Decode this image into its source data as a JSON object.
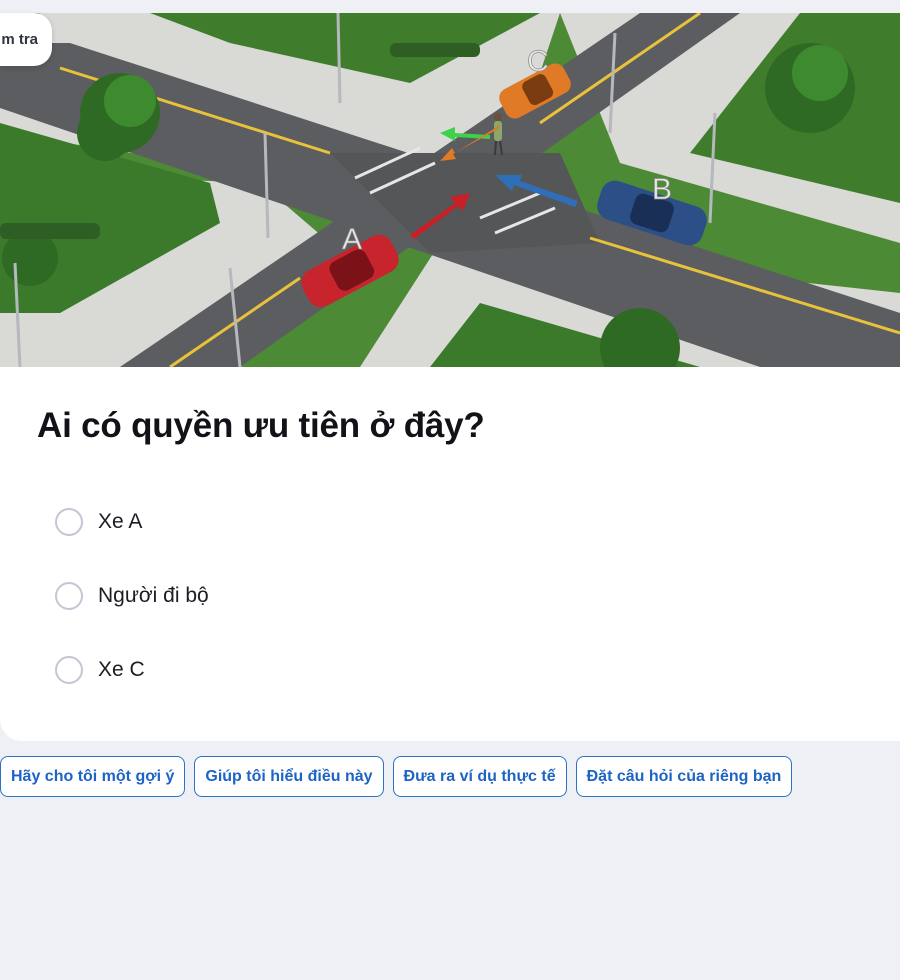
{
  "back_tab": {
    "label": "m tra"
  },
  "scene": {
    "labels": {
      "car_a": "A",
      "car_b": "B",
      "car_c": "C"
    },
    "colors": {
      "car_a": "#c8242e",
      "car_b": "#2b4f86",
      "car_c": "#e07a26"
    }
  },
  "question": {
    "text": "Ai có quyền ưu tiên ở đây?"
  },
  "options": [
    {
      "label": "Xe A",
      "selected": false
    },
    {
      "label": "Người đi bộ",
      "selected": false
    },
    {
      "label": "Xe C",
      "selected": false
    }
  ],
  "suggestions": [
    {
      "label": "Hãy cho tôi một gợi ý"
    },
    {
      "label": "Giúp tôi hiểu điều này"
    },
    {
      "label": "Đưa ra ví dụ thực tế"
    },
    {
      "label": "Đặt câu hỏi của riêng bạn"
    }
  ]
}
